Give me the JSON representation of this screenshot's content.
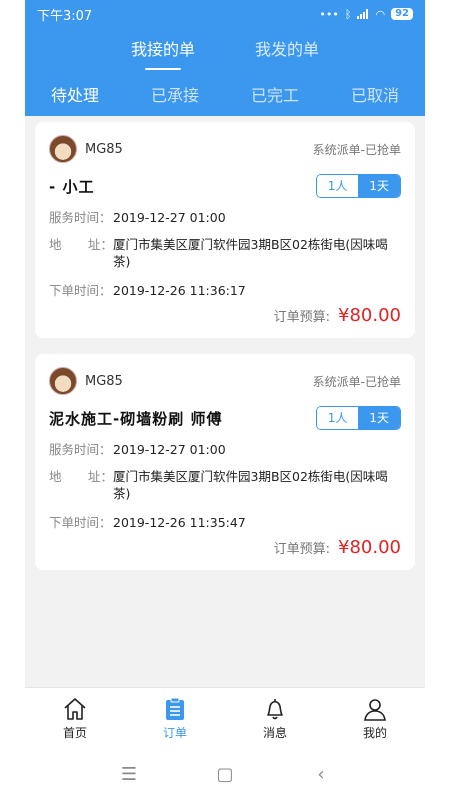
{
  "status_bar": {
    "time": "下午3:07",
    "battery": "92"
  },
  "top_tabs": [
    {
      "label": "我接的单"
    },
    {
      "label": "我发的单"
    }
  ],
  "sub_tabs": [
    {
      "label": "待处理"
    },
    {
      "label": "已承接"
    },
    {
      "label": "已完工"
    },
    {
      "label": "已取消"
    }
  ],
  "orders": [
    {
      "username": "MG85",
      "status": "系统派单-已抢单",
      "title": "-   小工",
      "workers": "1人",
      "days": "1天",
      "service_label": "服务时间：",
      "service_time": "2019-12-27 01:00",
      "address_label_a": "地",
      "address_label_b": "址：",
      "address": "厦门市集美区厦门软件园3期B区02栋街电(因味喝茶)",
      "order_label": "下单时间：",
      "order_time": "2019-12-26 11:36:17",
      "budget_label": "订单预算:",
      "budget": "¥80.00"
    },
    {
      "username": "MG85",
      "status": "系统派单-已抢单",
      "title": "泥水施工-砌墙粉刷   师傅",
      "workers": "1人",
      "days": "1天",
      "service_label": "服务时间：",
      "service_time": "2019-12-27 01:00",
      "address_label_a": "地",
      "address_label_b": "址：",
      "address": "厦门市集美区厦门软件园3期B区02栋街电(因味喝茶)",
      "order_label": "下单时间：",
      "order_time": "2019-12-26 11:35:47",
      "budget_label": "订单预算:",
      "budget": "¥80.00"
    }
  ],
  "tab_bar": [
    {
      "label": "首页",
      "icon": "home-icon"
    },
    {
      "label": "订单",
      "icon": "clipboard-icon"
    },
    {
      "label": "消息",
      "icon": "bell-icon"
    },
    {
      "label": "我的",
      "icon": "person-icon"
    }
  ],
  "nav_bar": {
    "menu": "☰",
    "home": "▢",
    "back": "‹"
  },
  "colors": {
    "primary": "#3b98ee",
    "price": "#e02424"
  }
}
